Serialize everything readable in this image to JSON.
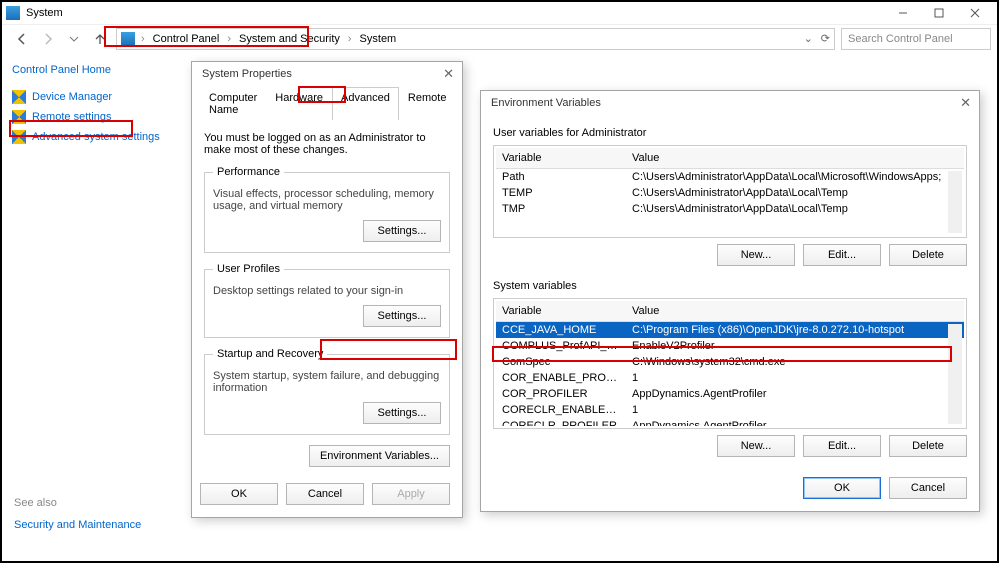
{
  "titlebar": {
    "app_title": "System"
  },
  "navrow": {
    "crumbs": [
      "Control Panel",
      "System and Security",
      "System"
    ],
    "search_placeholder": "Search Control Panel"
  },
  "sidebar": {
    "home": "Control Panel Home",
    "links": {
      "device_manager": "Device Manager",
      "remote_settings": "Remote settings",
      "advanced_system_settings": "Advanced system settings"
    },
    "see_also": "See also",
    "see_also_link": "Security and Maintenance"
  },
  "sysprops": {
    "title": "System Properties",
    "tabs": {
      "computer_name": "Computer Name",
      "hardware": "Hardware",
      "advanced": "Advanced",
      "remote": "Remote"
    },
    "note": "You must be logged on as an Administrator to make most of these changes.",
    "groups": {
      "performance": {
        "legend": "Performance",
        "text": "Visual effects, processor scheduling, memory usage, and virtual memory",
        "btn": "Settings..."
      },
      "user_profiles": {
        "legend": "User Profiles",
        "text": "Desktop settings related to your sign-in",
        "btn": "Settings..."
      },
      "startup": {
        "legend": "Startup and Recovery",
        "text": "System startup, system failure, and debugging information",
        "btn": "Settings..."
      }
    },
    "env_btn": "Environment Variables...",
    "ok": "OK",
    "cancel": "Cancel",
    "apply": "Apply"
  },
  "envdlg": {
    "title": "Environment Variables",
    "user_section": "User variables for Administrator",
    "sys_section": "System variables",
    "hdr_variable": "Variable",
    "hdr_value": "Value",
    "user_vars": [
      {
        "name": "Path",
        "value": "C:\\Users\\Administrator\\AppData\\Local\\Microsoft\\WindowsApps;"
      },
      {
        "name": "TEMP",
        "value": "C:\\Users\\Administrator\\AppData\\Local\\Temp"
      },
      {
        "name": "TMP",
        "value": "C:\\Users\\Administrator\\AppData\\Local\\Temp"
      }
    ],
    "sys_vars": [
      {
        "name": "CCE_JAVA_HOME",
        "value": "C:\\Program Files (x86)\\OpenJDK\\jre-8.0.272.10-hotspot"
      },
      {
        "name": "COMPLUS_ProfAPI_ProfilerC...",
        "value": "EnableV2Profiler"
      },
      {
        "name": "ComSpec",
        "value": "C:\\Windows\\system32\\cmd.exe"
      },
      {
        "name": "COR_ENABLE_PROFILING",
        "value": "1"
      },
      {
        "name": "COR_PROFILER",
        "value": "AppDynamics.AgentProfiler"
      },
      {
        "name": "CORECLR_ENABLE_PROFILI...",
        "value": "1"
      },
      {
        "name": "CORECLR_PROFILER",
        "value": "AppDynamics.AgentProfiler"
      }
    ],
    "new_btn": "New...",
    "edit_btn": "Edit...",
    "delete_btn": "Delete",
    "ok": "OK",
    "cancel": "Cancel"
  }
}
